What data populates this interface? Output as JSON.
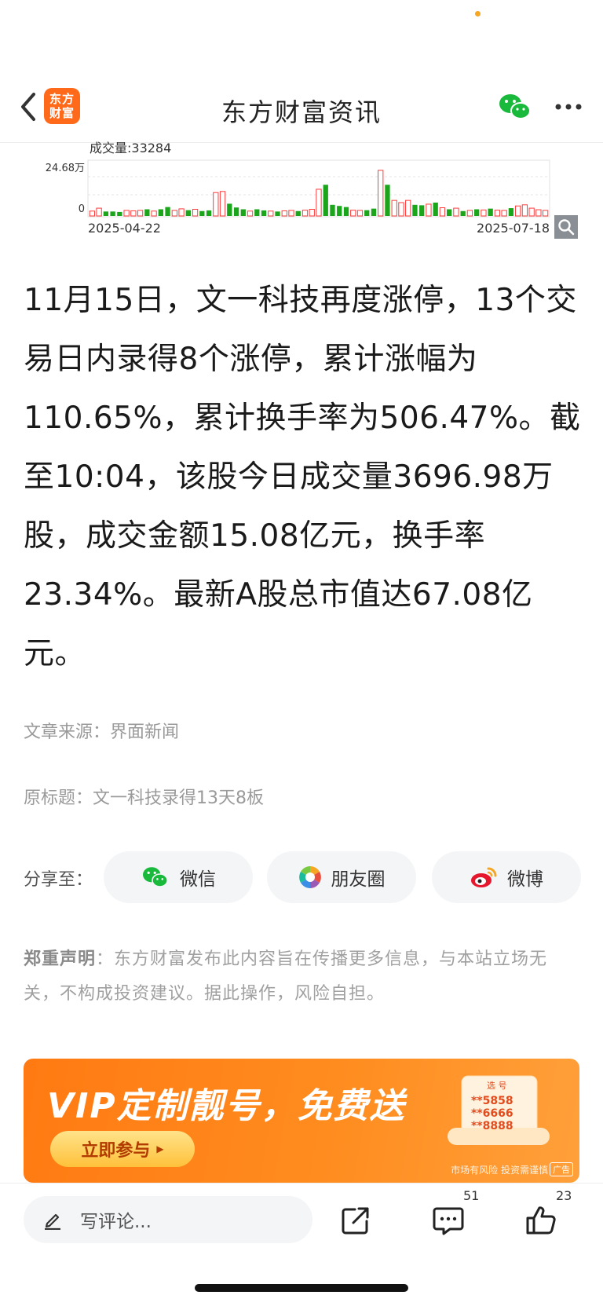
{
  "header": {
    "logo_line1": "东方",
    "logo_line2": "财富",
    "title": "东方财富资讯",
    "back_icon": "chevron-left-icon",
    "wechat_icon": "wechat-icon",
    "more_icon": "more-horizontal-icon"
  },
  "chart_data": {
    "type": "bar",
    "title": "成交量:33284",
    "y_max_label": "24.68万",
    "y_min_label": "0",
    "x_start_label": "2025-04-22",
    "x_end_label": "2025-07-18",
    "ylim": [
      0,
      24.68
    ],
    "colors": {
      "up": "#ff3b3b",
      "down": "#1aa51a"
    },
    "series": [
      {
        "values": [
          2.2,
          3.5,
          2.0,
          2.0,
          1.8,
          2.5,
          2.3,
          2.5,
          3.0,
          2.2,
          3.0,
          4.0,
          2.5,
          3.2,
          2.6,
          3.0,
          2.2,
          2.5,
          10.5,
          11.0,
          5.5,
          3.8,
          3.0,
          2.2,
          3.0,
          2.5,
          2.2,
          2.0,
          2.3,
          2.5,
          2.2,
          2.6,
          3.0,
          12.0,
          14.0,
          5.0,
          4.5,
          4.0,
          2.6,
          2.5,
          2.6,
          3.3,
          20.5,
          14.0,
          7.0,
          6.0,
          7.0,
          5.0,
          4.8,
          5.3,
          6.0,
          3.7,
          3.0,
          3.5,
          2.2,
          2.5,
          3.0,
          2.7,
          3.3,
          2.6,
          2.5,
          3.5,
          4.5,
          5.0,
          3.5,
          2.8,
          2.5
        ],
        "directions": [
          "u",
          "u",
          "d",
          "d",
          "d",
          "u",
          "u",
          "u",
          "d",
          "u",
          "d",
          "d",
          "u",
          "u",
          "d",
          "u",
          "d",
          "d",
          "u",
          "u",
          "d",
          "d",
          "d",
          "u",
          "d",
          "d",
          "u",
          "d",
          "u",
          "u",
          "d",
          "u",
          "u",
          "u",
          "d",
          "d",
          "d",
          "d",
          "u",
          "u",
          "d",
          "d",
          "u",
          "d",
          "u",
          "u",
          "u",
          "d",
          "d",
          "u",
          "d",
          "u",
          "d",
          "u",
          "d",
          "u",
          "d",
          "u",
          "d",
          "u",
          "u",
          "d",
          "u",
          "u",
          "u",
          "u",
          "u"
        ]
      }
    ]
  },
  "article": {
    "body": "11月15日，文一科技再度涨停，13个交易日内录得8个涨停，累计涨幅为110.65%，累计换手率为506.47%。截至10:04，该股今日成交量3696.98万股，成交金额15.08亿元，换手率23.34%。最新A股总市值达67.08亿元。",
    "source": "文章来源：界面新闻",
    "original_title": "原标题：文一科技录得13天8板"
  },
  "share": {
    "label": "分享至：",
    "wechat": "微信",
    "moments": "朋友圈",
    "weibo": "微博"
  },
  "disclaimer": {
    "label": "郑重声明",
    "text": "：东方财富发布此内容旨在传播更多信息，与本站立场无关，不构成投资建议。据此操作，风险自担。"
  },
  "banner": {
    "title": "VIP定制靓号，免费送",
    "button": "立即参与",
    "ticket_head": "选 号",
    "numbers": [
      "**5858",
      "**6666",
      "**8888"
    ],
    "risk_text": "市场有风险 投资需谨慎",
    "ad_tag": "广告"
  },
  "bottom_bar": {
    "comment_placeholder": "写评论...",
    "comments_count": "51",
    "likes_count": "23"
  }
}
